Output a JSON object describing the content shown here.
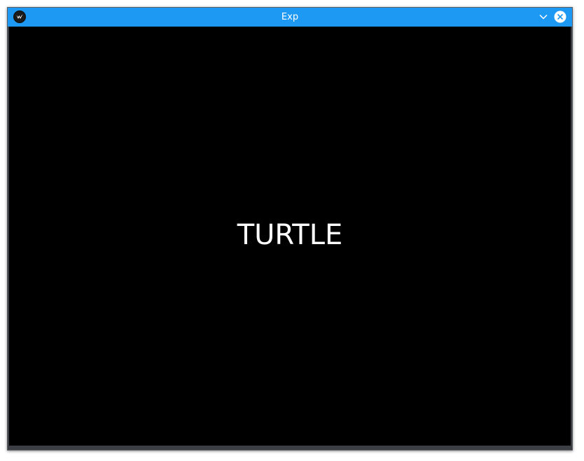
{
  "window": {
    "title": "Exp",
    "accent_color": "#1d99f3",
    "app_icon": "kivy-logo-icon",
    "buttons": {
      "menu_icon": "chevron-down-icon",
      "close_icon": "close-circle-icon"
    }
  },
  "canvas": {
    "background": "#000000",
    "text": "TURTLE",
    "text_color": "#ffffff"
  }
}
